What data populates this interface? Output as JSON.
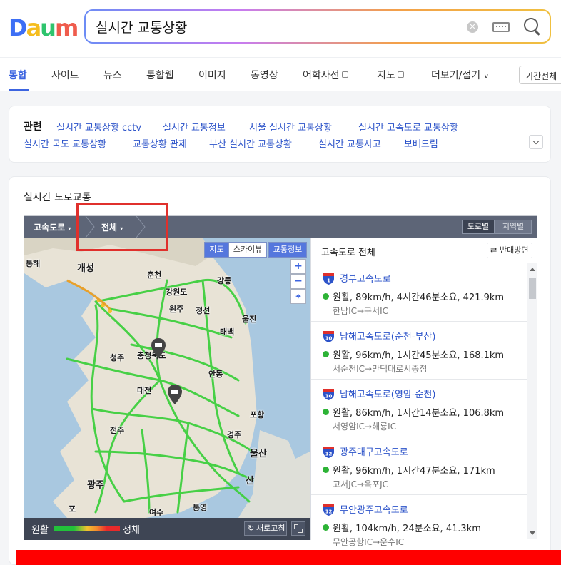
{
  "logo": {
    "text": "Daum"
  },
  "search": {
    "query": "실시간 교통상황"
  },
  "tabs": [
    {
      "label": "통합",
      "active": true
    },
    {
      "label": "사이트"
    },
    {
      "label": "뉴스"
    },
    {
      "label": "통합웹"
    },
    {
      "label": "이미지"
    },
    {
      "label": "동영상"
    },
    {
      "label": "어학사전"
    },
    {
      "label": "지도"
    },
    {
      "label": "더보기/접기"
    }
  ],
  "period_label": "기간전체",
  "related": {
    "label": "관련",
    "links": [
      "실시간 교통상황 cctv",
      "실시간 교통정보",
      "서울 실시간 교통상황",
      "실시간 고속도로 교통상황",
      "실시간 국도 교통상황",
      "교통상황 관제",
      "부산 실시간 교통상황",
      "실시간 교통사고",
      "보배드림"
    ]
  },
  "card": {
    "title": "실시간 도로교통"
  },
  "widget": {
    "crumb1": "고속도로",
    "crumb2": "전체",
    "seg_road": "도로별",
    "seg_region": "지역별",
    "map_buttons": [
      "지도",
      "스카이뷰",
      "교통정보"
    ],
    "zoom_in": "+",
    "zoom_out": "−",
    "cities": [
      "통해",
      "개성",
      "춘천",
      "강릉",
      "강원도",
      "원주",
      "정선",
      "태백",
      "울진",
      "충청북도",
      "청주",
      "안동",
      "대전",
      "포항",
      "전주",
      "경주",
      "울산",
      "광주",
      "산",
      "포",
      "통영",
      "여수"
    ],
    "legend_smooth": "원활",
    "legend_jam": "정체",
    "refresh": "새로고침",
    "list_title": "고속도로 전체",
    "reverse": "반대방면",
    "routes": [
      {
        "num": "1",
        "name": "경부고속도로",
        "status": "원활, 89km/h, 4시간46분소요, 421.9km",
        "section": "한남IC→구서IC"
      },
      {
        "num": "10",
        "name": "남해고속도로(순천-부산)",
        "status": "원활, 96km/h, 1시간45분소요, 168.1km",
        "section": "서순천IC→만덕대로시종점"
      },
      {
        "num": "10",
        "name": "남해고속도로(영암-순천)",
        "status": "원활, 86km/h, 1시간14분소요, 106.8km",
        "section": "서영암IC→해룡IC"
      },
      {
        "num": "12",
        "name": "광주대구고속도로",
        "status": "원활, 96km/h, 1시간47분소요, 171km",
        "section": "고서JC→옥포JC"
      },
      {
        "num": "12",
        "name": "무안광주고속도로",
        "status": "원활, 104km/h, 24분소요, 41.3km",
        "section": "무안공항IC→운수IC"
      }
    ]
  },
  "colors": {
    "accent": "#3c64e0",
    "smooth": "#2db336",
    "highlight": "#e0302c"
  }
}
